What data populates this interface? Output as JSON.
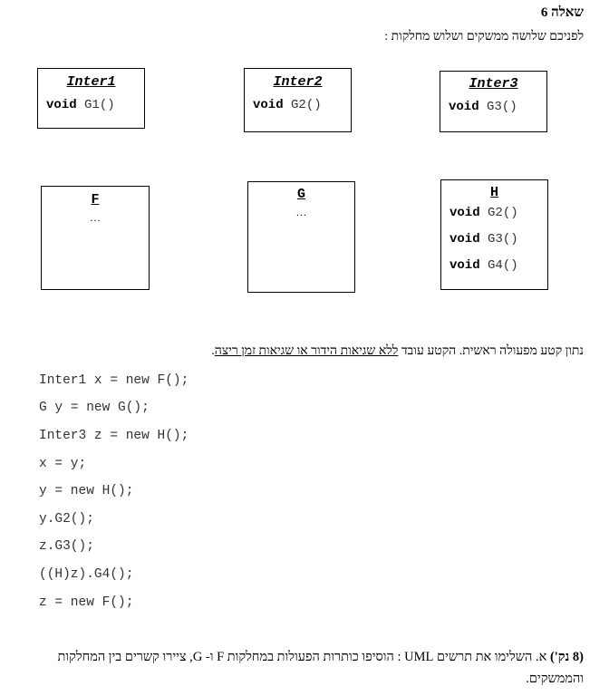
{
  "question_title": "שאלה 6",
  "intro": "לפניכם שלושה ממשקים ושלוש מחלקות :",
  "interfaces": [
    {
      "name": "Inter1",
      "keyword": "void",
      "method": "G1()"
    },
    {
      "name": "Inter2",
      "keyword": "void",
      "method": "G2()"
    },
    {
      "name": "Inter3",
      "keyword": "void",
      "method": "G3()"
    }
  ],
  "classes": {
    "F": {
      "name": "F",
      "body": "…"
    },
    "G": {
      "name": "G",
      "body": "…"
    },
    "H": {
      "name": "H",
      "methods": [
        {
          "keyword": "void",
          "method": "G2()"
        },
        {
          "keyword": "void",
          "method": "G3()"
        },
        {
          "keyword": "void",
          "method": "G4()"
        }
      ]
    }
  },
  "given": {
    "text_before": "נתון קטע מפעולה ראשית. הקטע עובד ",
    "underlined": "ללא שגיאות הידור או שגיאות זמן ריצה",
    "text_after": "."
  },
  "code_lines": [
    "Inter1 x = new F();",
    "G y = new G();",
    "Inter3 z = new H();",
    "x = y;",
    "y = new H();",
    "y.G2();",
    "z.G3();",
    "((H)z).G4();",
    "z = new F();"
  ],
  "task": {
    "points": "(8 נק')",
    "text": " א. השלימו את תרשים UML : הוסיפו כותרות הפעולות במחלקות F ו- G, ציירו קשרים בין המחלקות והממשקים."
  }
}
